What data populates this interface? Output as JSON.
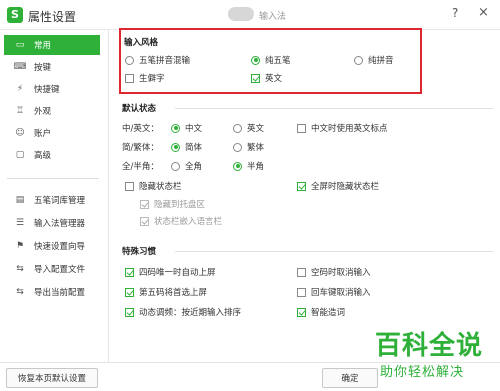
{
  "titlebar": {
    "title": "属性设置",
    "subtitle": "输入法",
    "help": "?",
    "close": "×",
    "logo": "S"
  },
  "sidebar": {
    "items": [
      {
        "label": "常用",
        "icon": "monitor-icon",
        "active": true
      },
      {
        "label": "按键",
        "icon": "keyboard-icon",
        "active": false
      },
      {
        "label": "快捷键",
        "icon": "lightning-icon",
        "active": false
      },
      {
        "label": "外观",
        "icon": "shirt-icon",
        "active": false
      },
      {
        "label": "账户",
        "icon": "user-icon",
        "active": false
      },
      {
        "label": "高级",
        "icon": "cube-icon",
        "active": false
      }
    ],
    "tools": [
      {
        "label": "五笔词库管理",
        "icon": "book-icon"
      },
      {
        "label": "输入法管理器",
        "icon": "list-icon"
      },
      {
        "label": "快速设置向导",
        "icon": "flag-icon"
      },
      {
        "label": "导入配置文件",
        "icon": "import-icon"
      },
      {
        "label": "导出当前配置",
        "icon": "export-icon"
      }
    ]
  },
  "input_style": {
    "heading": "输入风格",
    "options": [
      {
        "label": "五笔拼音混输",
        "checked": false
      },
      {
        "label": "纯五笔",
        "checked": true
      },
      {
        "label": "纯拼音",
        "checked": false
      }
    ],
    "checks": [
      {
        "label": "生僻字",
        "checked": false
      },
      {
        "label": "英文",
        "checked": true
      }
    ]
  },
  "default_state": {
    "heading": "默认状态",
    "rows": [
      {
        "label": "中/英文：",
        "opt1": "中文",
        "opt2": "英文",
        "sel": 1
      },
      {
        "label": "简/繁体：",
        "opt1": "简体",
        "opt2": "繁体",
        "sel": 1
      },
      {
        "label": "全/半角：",
        "opt1": "全角",
        "opt2": "半角",
        "sel": 2
      }
    ],
    "cn_punct": "中文时使用英文标点",
    "hide_status": "隐藏状态栏",
    "fullscreen_hide": "全屏时隐藏状态栏",
    "hide_tray": "隐藏到托盘区",
    "embed_lang": "状态栏嵌入语言栏"
  },
  "habits": {
    "heading": "特殊习惯",
    "items": [
      {
        "label": "四码唯一时自动上屏",
        "checked": true
      },
      {
        "label": "空码时取消输入",
        "checked": false
      },
      {
        "label": "第五码将首选上屏",
        "checked": true
      },
      {
        "label": "回车键取消输入",
        "checked": false
      },
      {
        "label": "动态调频：按近期输入排序",
        "checked": true
      },
      {
        "label": "智能造词",
        "checked": true
      }
    ]
  },
  "footer": {
    "restore": "恢复本页默认设置",
    "ok": "确定"
  },
  "watermark": {
    "title": "百科全说",
    "sub": "助你轻松解决"
  },
  "colors": {
    "accent": "#2eb039",
    "highlight": "#e0262e"
  }
}
